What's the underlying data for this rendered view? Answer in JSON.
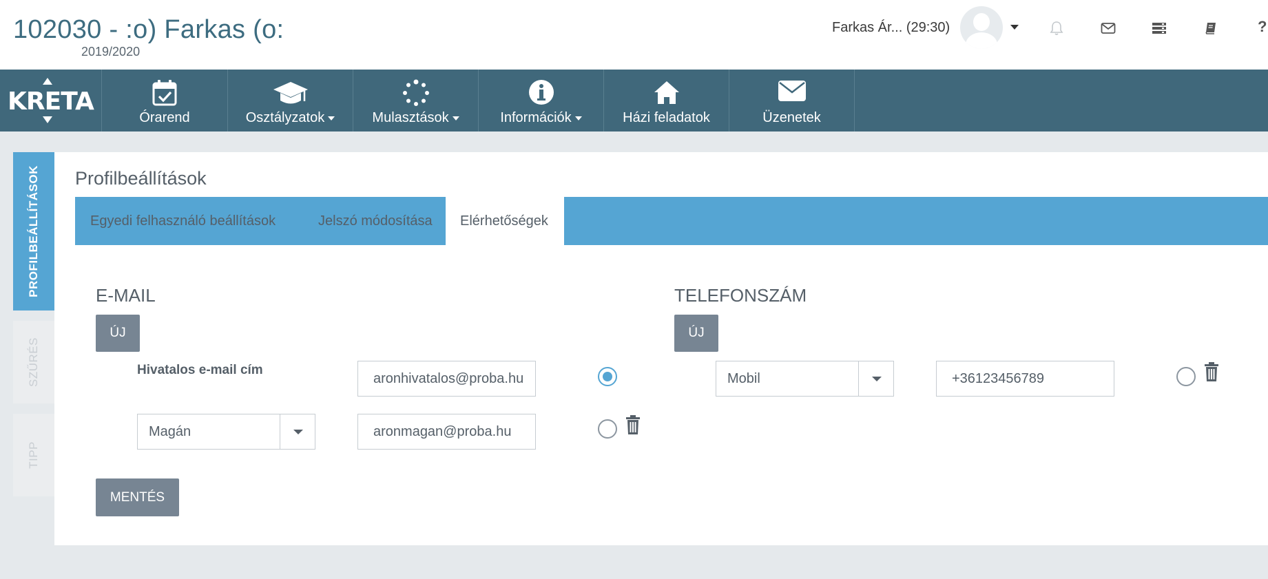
{
  "header": {
    "title": "102030 - :o) Farkas (o:",
    "school_year": "2019/2020",
    "user_label": "Farkas Ár... (29:30)",
    "icons": [
      "bell-icon",
      "envelope-icon",
      "server-icon",
      "book-icon"
    ],
    "help_label": "?"
  },
  "logo": {
    "text": "KRETA"
  },
  "nav": {
    "items": [
      {
        "label": "Órarend",
        "icon": "calendar-check-icon",
        "has_dropdown": false
      },
      {
        "label": "Osztályzatok",
        "icon": "graduation-cap-icon",
        "has_dropdown": true
      },
      {
        "label": "Mulasztások",
        "icon": "spinner-icon",
        "has_dropdown": true
      },
      {
        "label": "Információk",
        "icon": "info-circle-icon",
        "has_dropdown": true
      },
      {
        "label": "Házi feladatok",
        "icon": "home-icon",
        "has_dropdown": false
      },
      {
        "label": "Üzenetek",
        "icon": "envelope-icon",
        "has_dropdown": false
      }
    ]
  },
  "side_tabs": {
    "profile": "PROFILBEÁLLÍTÁSOK",
    "filter": "SZŰRÉS",
    "tip": "TIPP"
  },
  "panel": {
    "title": "Profilbeállítások",
    "tabs": [
      {
        "label": "Egyedi felhasználó beállítások",
        "active": false
      },
      {
        "label": "Jelszó módosítása",
        "active": false
      },
      {
        "label": "Elérhetőségek",
        "active": true
      }
    ]
  },
  "email": {
    "heading": "E-MAIL",
    "new_button": "ÚJ",
    "official_label": "Hivatalos e-mail cím",
    "official_value": "aronhivatalos@proba.hu",
    "official_primary": true,
    "private_type": "Magán",
    "private_value": "aronmagan@proba.hu",
    "private_primary": false
  },
  "phone": {
    "heading": "TELEFONSZÁM",
    "new_button": "ÚJ",
    "type": "Mobil",
    "value": "+36123456789",
    "primary": false
  },
  "save_button": "MENTÉS",
  "colors": {
    "header_teal": "#40687b",
    "accent_blue": "#55a5d3",
    "button_gray": "#778593",
    "title_teal": "#3d6c80"
  }
}
